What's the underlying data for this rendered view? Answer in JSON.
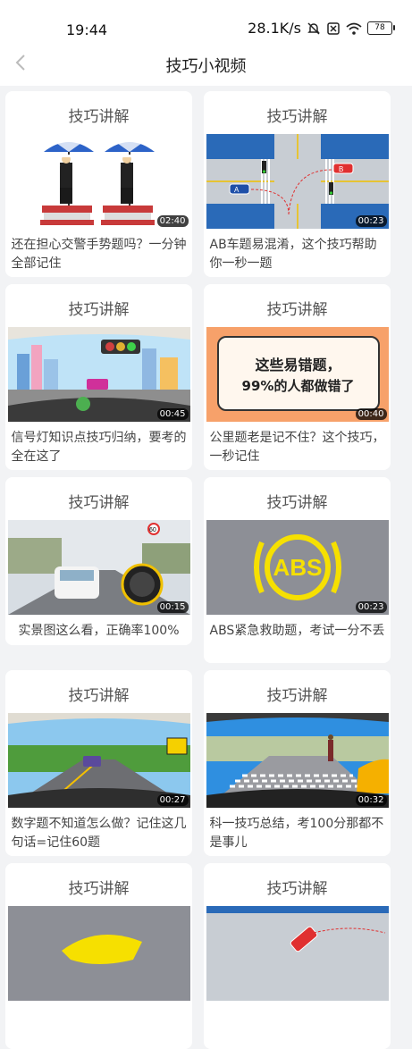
{
  "status": {
    "time": "19:44",
    "speed": "28.1K/s",
    "battery": "78"
  },
  "nav": {
    "title": "技巧小视频"
  },
  "cards": [
    {
      "title": "技巧讲解",
      "duration": "02:40",
      "caption": "还在担心交警手势题吗？一分钟全部记住"
    },
    {
      "title": "技巧讲解",
      "duration": "00:23",
      "caption": "AB车题易混淆，这个技巧帮助你一秒一题"
    },
    {
      "title": "技巧讲解",
      "duration": "00:45",
      "caption": "信号灯知识点技巧归纳，要考的全在这了"
    },
    {
      "title": "技巧讲解",
      "duration": "00:40",
      "caption": "公里题老是记不住？这个技巧，一秒记住",
      "thumb_text_1": "这些易错题，",
      "thumb_text_2": "99%的人都做错了"
    },
    {
      "title": "技巧讲解",
      "duration": "00:15",
      "caption": "实景图这么看，正确率100%",
      "thumb_sign": "60"
    },
    {
      "title": "技巧讲解",
      "duration": "00:23",
      "caption": "ABS紧急救助题，考试一分不丢",
      "thumb_text": "ABS"
    },
    {
      "title": "技巧讲解",
      "duration": "00:27",
      "caption": "数字题不知道怎么做？记住这几句话=记住60题"
    },
    {
      "title": "技巧讲解",
      "duration": "00:32",
      "caption": "科一技巧总结，考100分那都不是事儿"
    },
    {
      "title": "技巧讲解"
    },
    {
      "title": "技巧讲解"
    }
  ]
}
